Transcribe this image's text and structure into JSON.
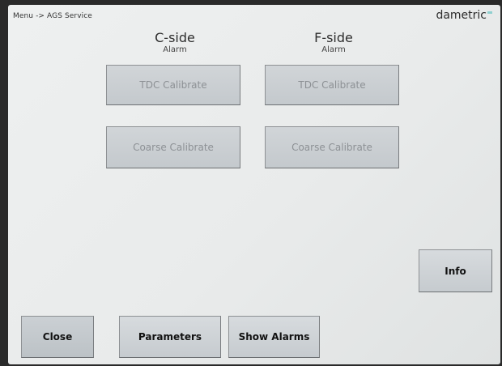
{
  "header": {
    "breadcrumb": "Menu -> AGS Service",
    "logo": "dametric"
  },
  "columns": [
    {
      "title": "C-side",
      "status": "Alarm",
      "tdc_label": "TDC Calibrate",
      "coarse_label": "Coarse Calibrate"
    },
    {
      "title": "F-side",
      "status": "Alarm",
      "tdc_label": "TDC Calibrate",
      "coarse_label": "Coarse Calibrate"
    }
  ],
  "side": {
    "info_label": "Info"
  },
  "footer": {
    "close_label": "Close",
    "parameters_label": "Parameters",
    "show_alarms_label": "Show Alarms"
  },
  "colors": {
    "screen_background": "#eceeee",
    "button_face": "#cfd3d6",
    "disabled_text": "#8d9195",
    "logo_accent": "#8fd0d0"
  }
}
